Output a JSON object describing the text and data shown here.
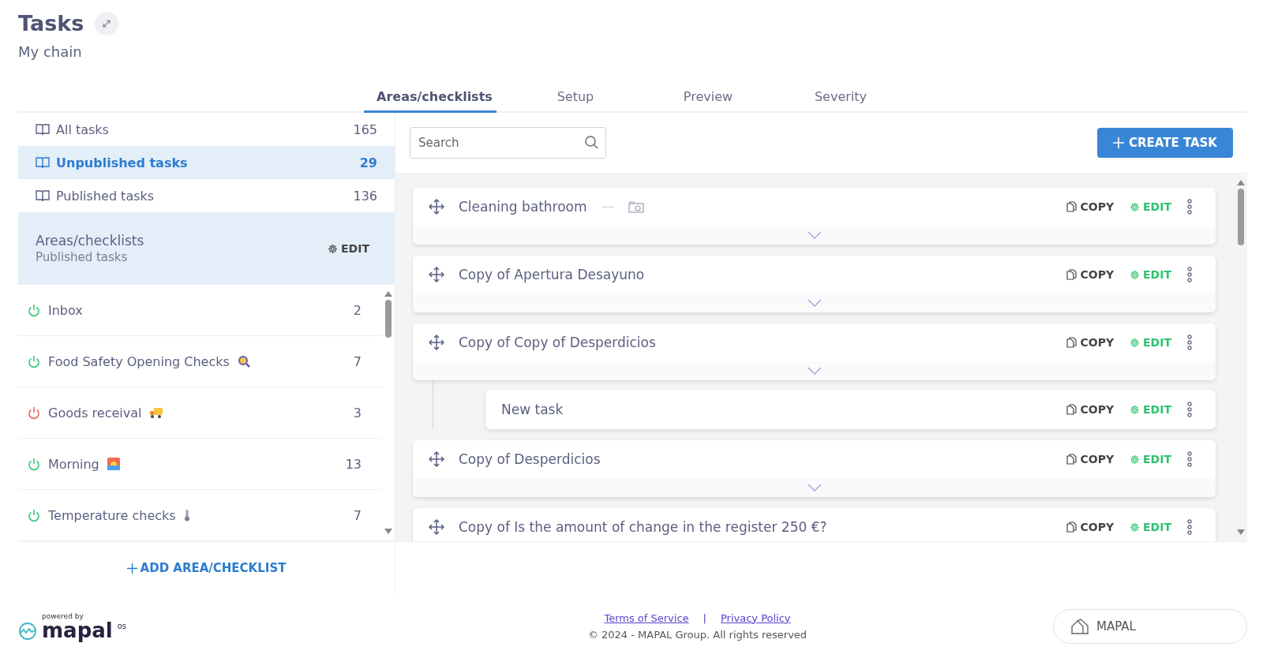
{
  "header": {
    "title": "Tasks",
    "subtitle": "My chain"
  },
  "tabs": [
    {
      "label": "Areas/checklists",
      "selected": true
    },
    {
      "label": "Setup",
      "selected": false
    },
    {
      "label": "Preview",
      "selected": false
    },
    {
      "label": "Severity",
      "selected": false
    }
  ],
  "filters": [
    {
      "label": "All tasks",
      "count": "165",
      "selected": false
    },
    {
      "label": "Unpublished tasks",
      "count": "29",
      "selected": true
    },
    {
      "label": "Published tasks",
      "count": "136",
      "selected": false
    }
  ],
  "areas_header": {
    "title": "Areas/checklists",
    "subtitle": "Published tasks",
    "edit_label": "EDIT"
  },
  "areas": [
    {
      "name": "Inbox",
      "count": "2",
      "color": "#3cc878",
      "kind": "none"
    },
    {
      "name": "Food Safety Opening Checks",
      "count": "7",
      "color": "#3cc878",
      "kind": "magnifier"
    },
    {
      "name": "Goods receival",
      "count": "3",
      "color": "#f06464",
      "kind": "truck"
    },
    {
      "name": "Morning",
      "count": "13",
      "color": "#3cc878",
      "kind": "sunrise"
    },
    {
      "name": "Temperature checks",
      "count": "7",
      "color": "#3cc878",
      "kind": "thermometer"
    }
  ],
  "add_area_label": "ADD AREA/CHECKLIST",
  "search": {
    "placeholder": "Search"
  },
  "create_task_label": "CREATE TASK",
  "tasks": [
    {
      "title": "Cleaning bathroom",
      "photo": true,
      "copy_label": "COPY",
      "edit_label": "EDIT"
    },
    {
      "title": "Copy of Apertura Desayuno",
      "photo": false,
      "copy_label": "COPY",
      "edit_label": "EDIT"
    },
    {
      "title": "Copy of Copy of Desperdicios",
      "photo": false,
      "copy_label": "COPY",
      "edit_label": "EDIT",
      "children": [
        {
          "title": "New task",
          "photo": false,
          "copy_label": "COPY",
          "edit_label": "EDIT"
        }
      ]
    },
    {
      "title": "Copy of Desperdicios",
      "photo": false,
      "copy_label": "COPY",
      "edit_label": "EDIT"
    },
    {
      "title": "Copy of Is the amount of change in the register 250 €?",
      "photo": false,
      "copy_label": "COPY",
      "edit_label": "EDIT"
    }
  ],
  "footer": {
    "powered_by": "powered by",
    "brand": "mapal",
    "brand_suffix": "os",
    "links": [
      "Terms of Service",
      "Privacy Policy"
    ],
    "separator": "|",
    "copyright": "© 2024 - MAPAL Group. All rights reserved",
    "org_button": "MAPAL"
  }
}
